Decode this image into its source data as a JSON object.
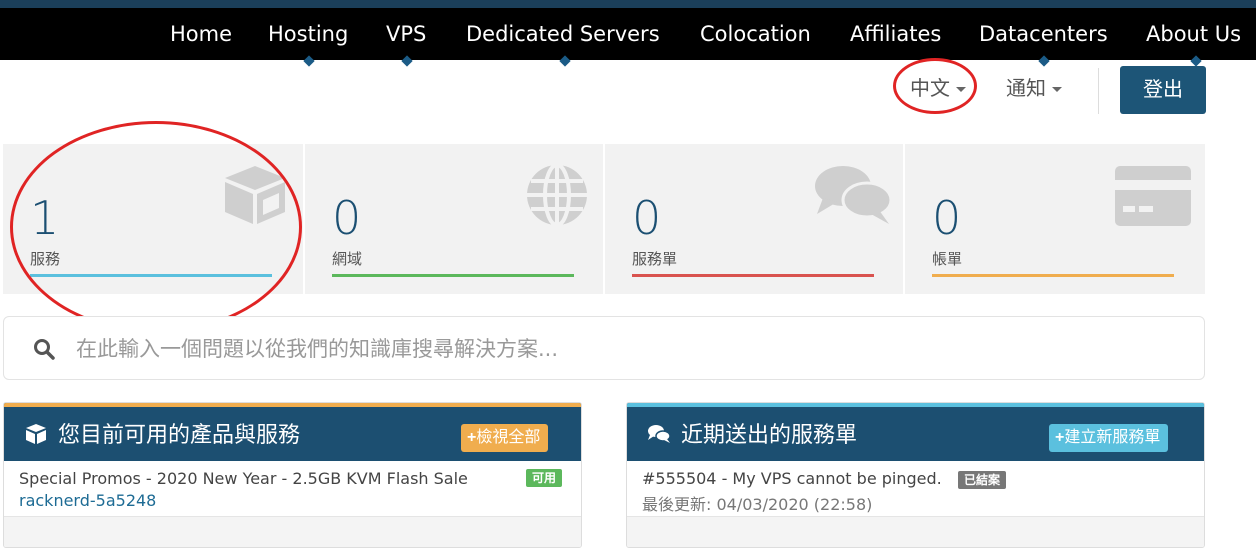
{
  "nav": {
    "items": [
      {
        "label": "Home"
      },
      {
        "label": "Hosting"
      },
      {
        "label": "VPS"
      },
      {
        "label": "Dedicated Servers"
      },
      {
        "label": "Colocation"
      },
      {
        "label": "Affiliates"
      },
      {
        "label": "Datacenters"
      },
      {
        "label": "About Us"
      }
    ]
  },
  "header": {
    "language": "中文",
    "notifications": "通知",
    "logout": "登出"
  },
  "stats": [
    {
      "value": "1",
      "label": "服務",
      "icon": "cube-icon",
      "color": "#5bc0de"
    },
    {
      "value": "0",
      "label": "網域",
      "icon": "globe-icon",
      "color": "#5cb85c"
    },
    {
      "value": "0",
      "label": "服務單",
      "icon": "comments-icon",
      "color": "#d9534f"
    },
    {
      "value": "0",
      "label": "帳單",
      "icon": "credit-card-icon",
      "color": "#f0ad4e"
    }
  ],
  "search": {
    "placeholder": "在此輸入一個問題以從我們的知識庫搜尋解決方案..."
  },
  "panels": {
    "services": {
      "title": "您目前可用的產品與服務",
      "button": "檢視全部",
      "accent": "#f0ad4e",
      "item": {
        "name": "Special Promos - 2020 New Year - 2.5GB KVM Flash Sale",
        "domain": "racknerd-5a5248",
        "status": "可用",
        "status_color": "#5cb85c"
      }
    },
    "tickets": {
      "title": "近期送出的服務單",
      "button": "建立新服務單",
      "accent": "#5bc0de",
      "item": {
        "subject": "#555504 - My VPS cannot be pinged.",
        "status": "已結案",
        "status_color": "#777777",
        "updated": "最後更新: 04/03/2020 (22:58)"
      }
    }
  }
}
